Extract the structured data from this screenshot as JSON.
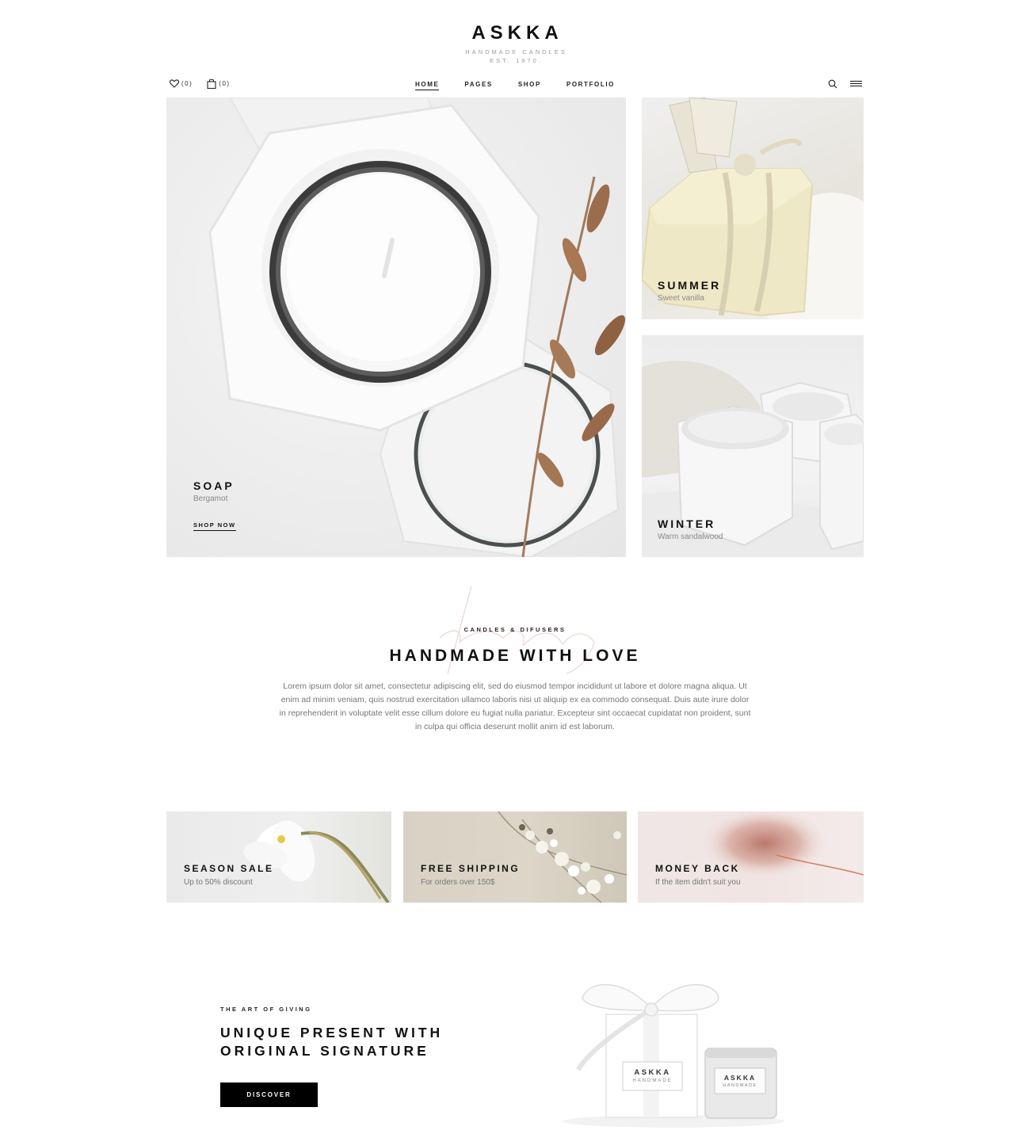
{
  "header": {
    "logo_title": "ASKKA",
    "logo_tagline": "HANDMADE CANDLES",
    "logo_established": "EST. 1970.",
    "wishlist_count": "(0)",
    "cart_count": "(0)",
    "nav": [
      "HOME",
      "PAGES",
      "SHOP",
      "PORTFOLIO"
    ],
    "icons": [
      "heart-icon",
      "shopping-bag-icon",
      "search-icon",
      "menu-icon"
    ]
  },
  "hero": {
    "main": {
      "title": "SOAP",
      "subtitle": "Bergamot",
      "link": "SHOP NOW"
    },
    "summer": {
      "title": "SUMMER",
      "subtitle": "Sweet vanilla"
    },
    "winter": {
      "title": "WINTER",
      "subtitle": "Warm sandalwood"
    }
  },
  "intro": {
    "eyebrow": "CANDLES & DIFUSERS",
    "title": "HANDMADE WITH LOVE",
    "text": "Lorem ipsum dolor sit amet, consectetur adipiscing elit, sed do eiusmod tempor incididunt ut labore et dolore magna aliqua. Ut enim ad minim veniam, quis nostrud exercitation ullamco laboris nisi ut aliquip ex ea commodo consequat. Duis aute irure dolor in reprehenderit in voluptate velit esse cillum dolore eu fugiat nulla pariatur. Excepteur sint occaecat cupidatat non proident, sunt in culpa qui officia deserunt mollit anim id est laborum."
  },
  "features": [
    {
      "title": "SEASON SALE",
      "subtitle": "Up to 50% discount"
    },
    {
      "title": "FREE SHIPPING",
      "subtitle": "For orders over 150$"
    },
    {
      "title": "MONEY BACK",
      "subtitle": "If the item didn't suit you"
    }
  ],
  "promo": {
    "eyebrow": "THE ART OF GIVING",
    "title": "UNIQUE PRESENT WITH ORIGINAL SIGNATURE",
    "button": "DISCOVER",
    "box_brand": "ASKKA",
    "box_label": "HANDMADE"
  },
  "colors": {
    "text": "#111111",
    "muted": "#777777",
    "button_bg": "#000000",
    "button_text": "#ffffff"
  }
}
